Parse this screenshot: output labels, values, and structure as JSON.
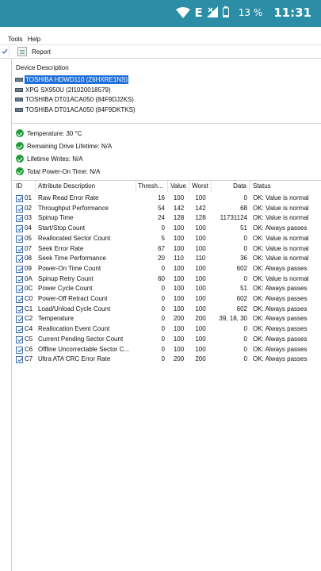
{
  "statusbar": {
    "network": "E",
    "battery": "13 %",
    "time": "11:31"
  },
  "menu": {
    "tools": "Tools",
    "help": "Help"
  },
  "toolbar": {
    "report": "Report"
  },
  "devices": {
    "header": "Device Description",
    "items": [
      "TOSHIBA HDWD110 (Z6HXRE1NS)",
      "XPG SX950U (2I1020018579)",
      "TOSHIBA DT01ACA050 (84F9DJ2KS)",
      "TOSHIBA DT01ACA050 (84F9DKTKS)"
    ]
  },
  "status": {
    "temperature": "Temperature: 30 °C",
    "lifetime": "Remaining Drive Lifetime: N/A",
    "writes": "Lifetime Writes: N/A",
    "power_on": "Total Power-On Time: N/A"
  },
  "table": {
    "headers": {
      "id": "ID",
      "attr": "Attribute Description",
      "thresh": "Thresh...",
      "value": "Value",
      "worst": "Worst",
      "data": "Data",
      "status": "Status"
    },
    "rows": [
      {
        "id": "01",
        "attr": "Raw Read Error Rate",
        "thresh": "16",
        "value": "100",
        "worst": "100",
        "data": "0",
        "status": "OK: Value is normal"
      },
      {
        "id": "02",
        "attr": "Throughput Performance",
        "thresh": "54",
        "value": "142",
        "worst": "142",
        "data": "68",
        "status": "OK: Value is normal"
      },
      {
        "id": "03",
        "attr": "Spinup Time",
        "thresh": "24",
        "value": "128",
        "worst": "128",
        "data": "11731124",
        "status": "OK: Value is normal"
      },
      {
        "id": "04",
        "attr": "Start/Stop Count",
        "thresh": "0",
        "value": "100",
        "worst": "100",
        "data": "51",
        "status": "OK: Always passes"
      },
      {
        "id": "05",
        "attr": "Reallocated Sector Count",
        "thresh": "5",
        "value": "100",
        "worst": "100",
        "data": "0",
        "status": "OK: Value is normal"
      },
      {
        "id": "07",
        "attr": "Seek Error Rate",
        "thresh": "67",
        "value": "100",
        "worst": "100",
        "data": "0",
        "status": "OK: Value is normal"
      },
      {
        "id": "08",
        "attr": "Seek Time Performance",
        "thresh": "20",
        "value": "110",
        "worst": "110",
        "data": "36",
        "status": "OK: Value is normal"
      },
      {
        "id": "09",
        "attr": "Power-On Time Count",
        "thresh": "0",
        "value": "100",
        "worst": "100",
        "data": "602",
        "status": "OK: Always passes"
      },
      {
        "id": "0A",
        "attr": "Spinup Retry Count",
        "thresh": "60",
        "value": "100",
        "worst": "100",
        "data": "0",
        "status": "OK: Value is normal"
      },
      {
        "id": "0C",
        "attr": "Power Cycle Count",
        "thresh": "0",
        "value": "100",
        "worst": "100",
        "data": "51",
        "status": "OK: Always passes"
      },
      {
        "id": "C0",
        "attr": "Power-Off Retract Count",
        "thresh": "0",
        "value": "100",
        "worst": "100",
        "data": "602",
        "status": "OK: Always passes"
      },
      {
        "id": "C1",
        "attr": "Load/Unload Cycle Count",
        "thresh": "0",
        "value": "100",
        "worst": "100",
        "data": "602",
        "status": "OK: Always passes"
      },
      {
        "id": "C2",
        "attr": "Temperature",
        "thresh": "0",
        "value": "200",
        "worst": "200",
        "data": "39, 18, 30",
        "status": "OK: Always passes"
      },
      {
        "id": "C4",
        "attr": "Reallocation Event Count",
        "thresh": "0",
        "value": "100",
        "worst": "100",
        "data": "0",
        "status": "OK: Always passes"
      },
      {
        "id": "C5",
        "attr": "Current Pending Sector Count",
        "thresh": "0",
        "value": "100",
        "worst": "100",
        "data": "0",
        "status": "OK: Always passes"
      },
      {
        "id": "C6",
        "attr": "Offline Uncorrectable Sector C...",
        "thresh": "0",
        "value": "100",
        "worst": "100",
        "data": "0",
        "status": "OK: Always passes"
      },
      {
        "id": "C7",
        "attr": "Ultra ATA CRC Error Rate",
        "thresh": "0",
        "value": "200",
        "worst": "200",
        "data": "0",
        "status": "OK: Always passes"
      }
    ]
  }
}
